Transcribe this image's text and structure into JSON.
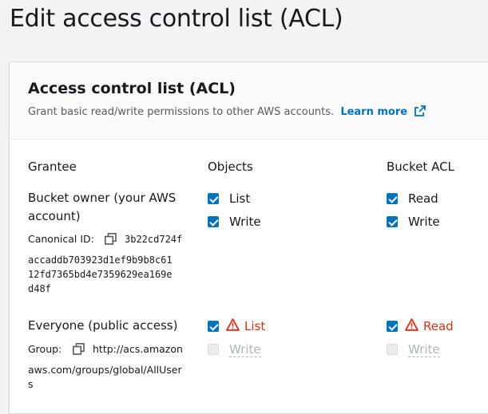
{
  "page": {
    "title": "Edit access control list (ACL)"
  },
  "panel": {
    "title": "Access control list (ACL)",
    "description": "Grant basic read/write permissions to other AWS accounts.",
    "learn_more": "Learn more"
  },
  "columns": {
    "grantee": "Grantee",
    "objects": "Objects",
    "bucket_acl": "Bucket ACL"
  },
  "rows": {
    "owner": {
      "name_line1": "Bucket owner (your AWS",
      "name_line2": "account)",
      "id_label": "Canonical ID:",
      "id_line1": "3b22cd724f",
      "id_line2": "accaddb703923d1ef9b9b8c61",
      "id_line3": "12fd7365bd4e7359629ea169e",
      "id_line4": "d48f",
      "objects": {
        "list": "List",
        "write": "Write"
      },
      "bucket": {
        "read": "Read",
        "write": "Write"
      }
    },
    "everyone": {
      "name": "Everyone (public access)",
      "group_label": "Group:",
      "group_line1": "http://acs.amazon",
      "group_line2": "aws.com/groups/global/AllUser",
      "group_line3": "s",
      "objects": {
        "list": "List",
        "write": "Write"
      },
      "bucket": {
        "read": "Read",
        "write": "Write"
      }
    }
  },
  "colors": {
    "accent": "#0073bb",
    "warning": "#d13212",
    "disabled": "#aab7b8"
  },
  "icons": [
    "external-link-icon",
    "copy-icon",
    "warning-icon"
  ]
}
